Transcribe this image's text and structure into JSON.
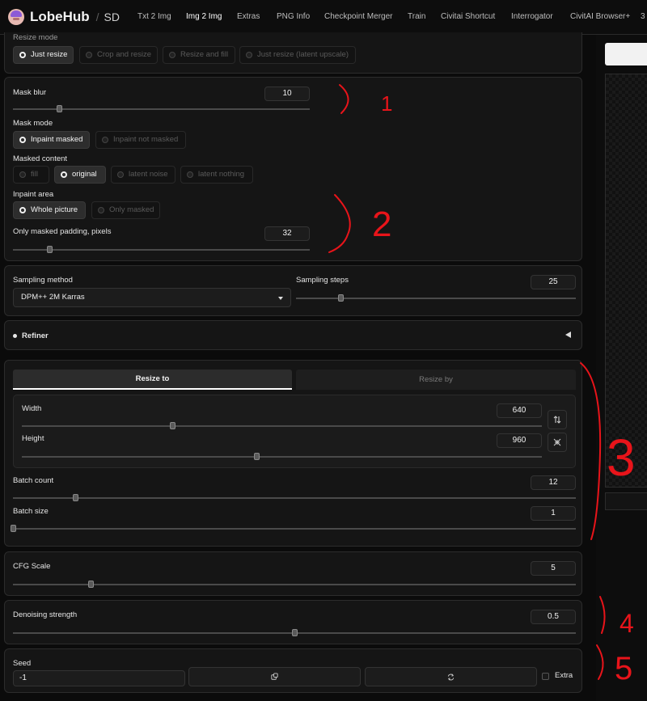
{
  "header": {
    "brand": "LobeHub",
    "separator": "/",
    "product": "SD",
    "tabs": [
      {
        "label": "Txt 2 Img",
        "active": false
      },
      {
        "label": "Img 2 Img",
        "active": true
      },
      {
        "label": "Extras",
        "active": false
      },
      {
        "label": "PNG Info",
        "active": false
      },
      {
        "label": "Checkpoint Merger",
        "active": false
      },
      {
        "label": "Train",
        "active": false
      },
      {
        "label": "Civitai Shortcut",
        "active": false
      },
      {
        "label": "Interrogator",
        "active": false
      },
      {
        "label": "CivitAI Browser+",
        "active": false
      },
      {
        "label": "3",
        "active": false
      }
    ]
  },
  "resize_mode": {
    "label": "Resize mode",
    "options": [
      "Just resize",
      "Crop and resize",
      "Resize and fill",
      "Just resize (latent upscale)"
    ],
    "selected": "Just resize"
  },
  "inpaint": {
    "mask_blur": {
      "label": "Mask blur",
      "value": "10",
      "min": 0,
      "max": 64
    },
    "mask_mode": {
      "label": "Mask mode",
      "options": [
        "Inpaint masked",
        "Inpaint not masked"
      ],
      "selected": "Inpaint masked"
    },
    "masked_content": {
      "label": "Masked content",
      "options": [
        "fill",
        "original",
        "latent noise",
        "latent nothing"
      ],
      "selected": "original"
    },
    "inpaint_area": {
      "label": "Inpaint area",
      "options": [
        "Whole picture",
        "Only masked"
      ],
      "selected": "Whole picture"
    },
    "padding": {
      "label": "Only masked padding, pixels",
      "value": "32",
      "min": 0,
      "max": 256
    }
  },
  "sampling": {
    "method_label": "Sampling method",
    "method_value": "DPM++ 2M Karras",
    "steps_label": "Sampling steps",
    "steps_value": "25",
    "steps_min": 1,
    "steps_max": 150
  },
  "refiner": {
    "label": "Refiner"
  },
  "size": {
    "tab_resize_to": "Resize to",
    "tab_resize_by": "Resize by",
    "width": {
      "label": "Width",
      "value": "640",
      "min": 64,
      "max": 2048
    },
    "height": {
      "label": "Height",
      "value": "960",
      "min": 64,
      "max": 2048
    }
  },
  "batch": {
    "count": {
      "label": "Batch count",
      "value": "12",
      "min": 1,
      "max": 100
    },
    "size": {
      "label": "Batch size",
      "value": "1",
      "min": 1,
      "max": 8
    }
  },
  "cfg": {
    "label": "CFG Scale",
    "value": "5",
    "min": 1,
    "max": 30
  },
  "denoise": {
    "label": "Denoising strength",
    "value": "0.5",
    "min": 0,
    "max": 1
  },
  "seed": {
    "label": "Seed",
    "value": "-1",
    "extra_label": "Extra"
  },
  "annotations": [
    "1",
    "2",
    "3",
    "4",
    "5"
  ],
  "colors": {
    "annotation": "#e8141a",
    "background": "#0b0b0b",
    "panel": "#151515"
  },
  "icons": [
    "swap-dimensions-icon",
    "aspect-ratio-icon",
    "dice-icon",
    "recycle-icon"
  ]
}
